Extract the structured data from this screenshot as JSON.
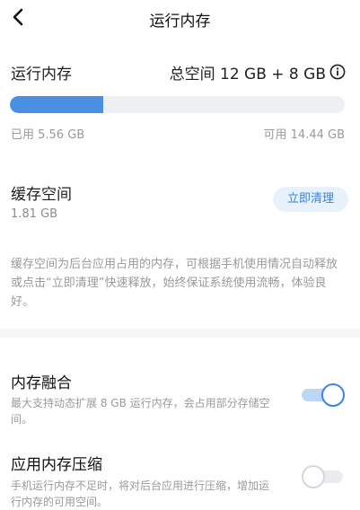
{
  "header": {
    "title": "运行内存"
  },
  "ram": {
    "label": "运行内存",
    "total": "总空间 12 GB + 8 GB",
    "used": "已用 5.56 GB",
    "available": "可用 14.44 GB",
    "used_fraction": 0.278,
    "bar_color": "#4a90e2"
  },
  "cache": {
    "title": "缓存空间",
    "size": "1.81 GB",
    "clean_button": "立即清理",
    "description": "缓存空间为后台应用占用的内存，可根据手机使用情况自动释放或点击“立即清理”快速释放，始终保证系统使用流畅，体验良好。"
  },
  "memory_fusion": {
    "title": "内存融合",
    "description": "最大支持动态扩展 8 GB 运行内存，会占用部分存储空间。",
    "enabled": true
  },
  "memory_compression": {
    "title": "应用内存压缩",
    "description": "手机运行内存不足时，将对后台应用进行压缩，增加运行内存的可用空间。",
    "enabled": false
  },
  "colors": {
    "accent": "#3a86e0",
    "muted_text": "#9a9a9a"
  },
  "icons": {
    "back": "chevron-left-icon",
    "info": "info-icon"
  }
}
